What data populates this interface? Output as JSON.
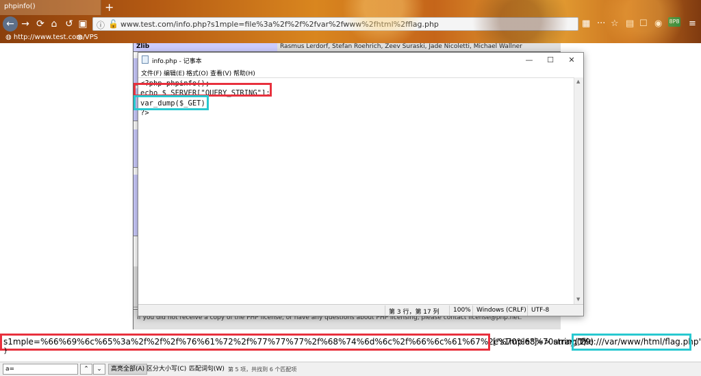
{
  "browser": {
    "tab_title": "phpinfo()",
    "new_tab_symbol": "+",
    "url": "www.test.com/info.php?s1mple=file%3a%2f%2f%2fvar%2fwww%2fhtml%2fflag.php",
    "badge": "8P8",
    "bookmarks": [
      "http://www.test.com/",
      "VPS"
    ]
  },
  "phpinfo": {
    "zlib_label": "Zlib",
    "zlib_authors": "Rasmus Lerdorf, Stefan Roehrich, Zeev Suraski, Jade Nicoletti, Michael Wallner",
    "license_text": "If you did not receive a copy of the PHP license, or have any questions about PHP licensing, please contact license@php.net."
  },
  "notepad": {
    "title": "info.php - 记事本",
    "menu": [
      "文件(F)",
      "编辑(E)",
      "格式(O)",
      "查看(V)",
      "帮助(H)"
    ],
    "code_lines": [
      "<?php phpinfo();",
      "echo $_SERVER[\"QUERY_STRING\"];",
      "var_dump($_GET);",
      "?>"
    ],
    "status": {
      "position": "第 3 行，第 17 列",
      "zoom": "100%",
      "line_ending": "Windows (CRLF)",
      "encoding": "UTF-8"
    }
  },
  "output": {
    "query_string": "s1mple=%66%69%6c%65%3a%2f%2f%2f%76%61%72%2f%77%77%77%2f%68%74%6d%6c%2f%66%6c%61%67%2e%70%68%70array(1)",
    "dump_mid": "[\"s1mple\"]=> string(29)",
    "dump_value": "\"file:///var/www/html/flag.php\"",
    "close_brace": "}"
  },
  "findbar": {
    "input_value": "a=",
    "highlight_all": "高亮全部(A)",
    "match_case": "区分大小写(C)",
    "whole_words": "匹配词句(W)",
    "status": "第 5 项，共找到 6 个匹配项"
  },
  "colors": {
    "highlight_red": "#e8303d",
    "highlight_cyan": "#28c8d0"
  }
}
